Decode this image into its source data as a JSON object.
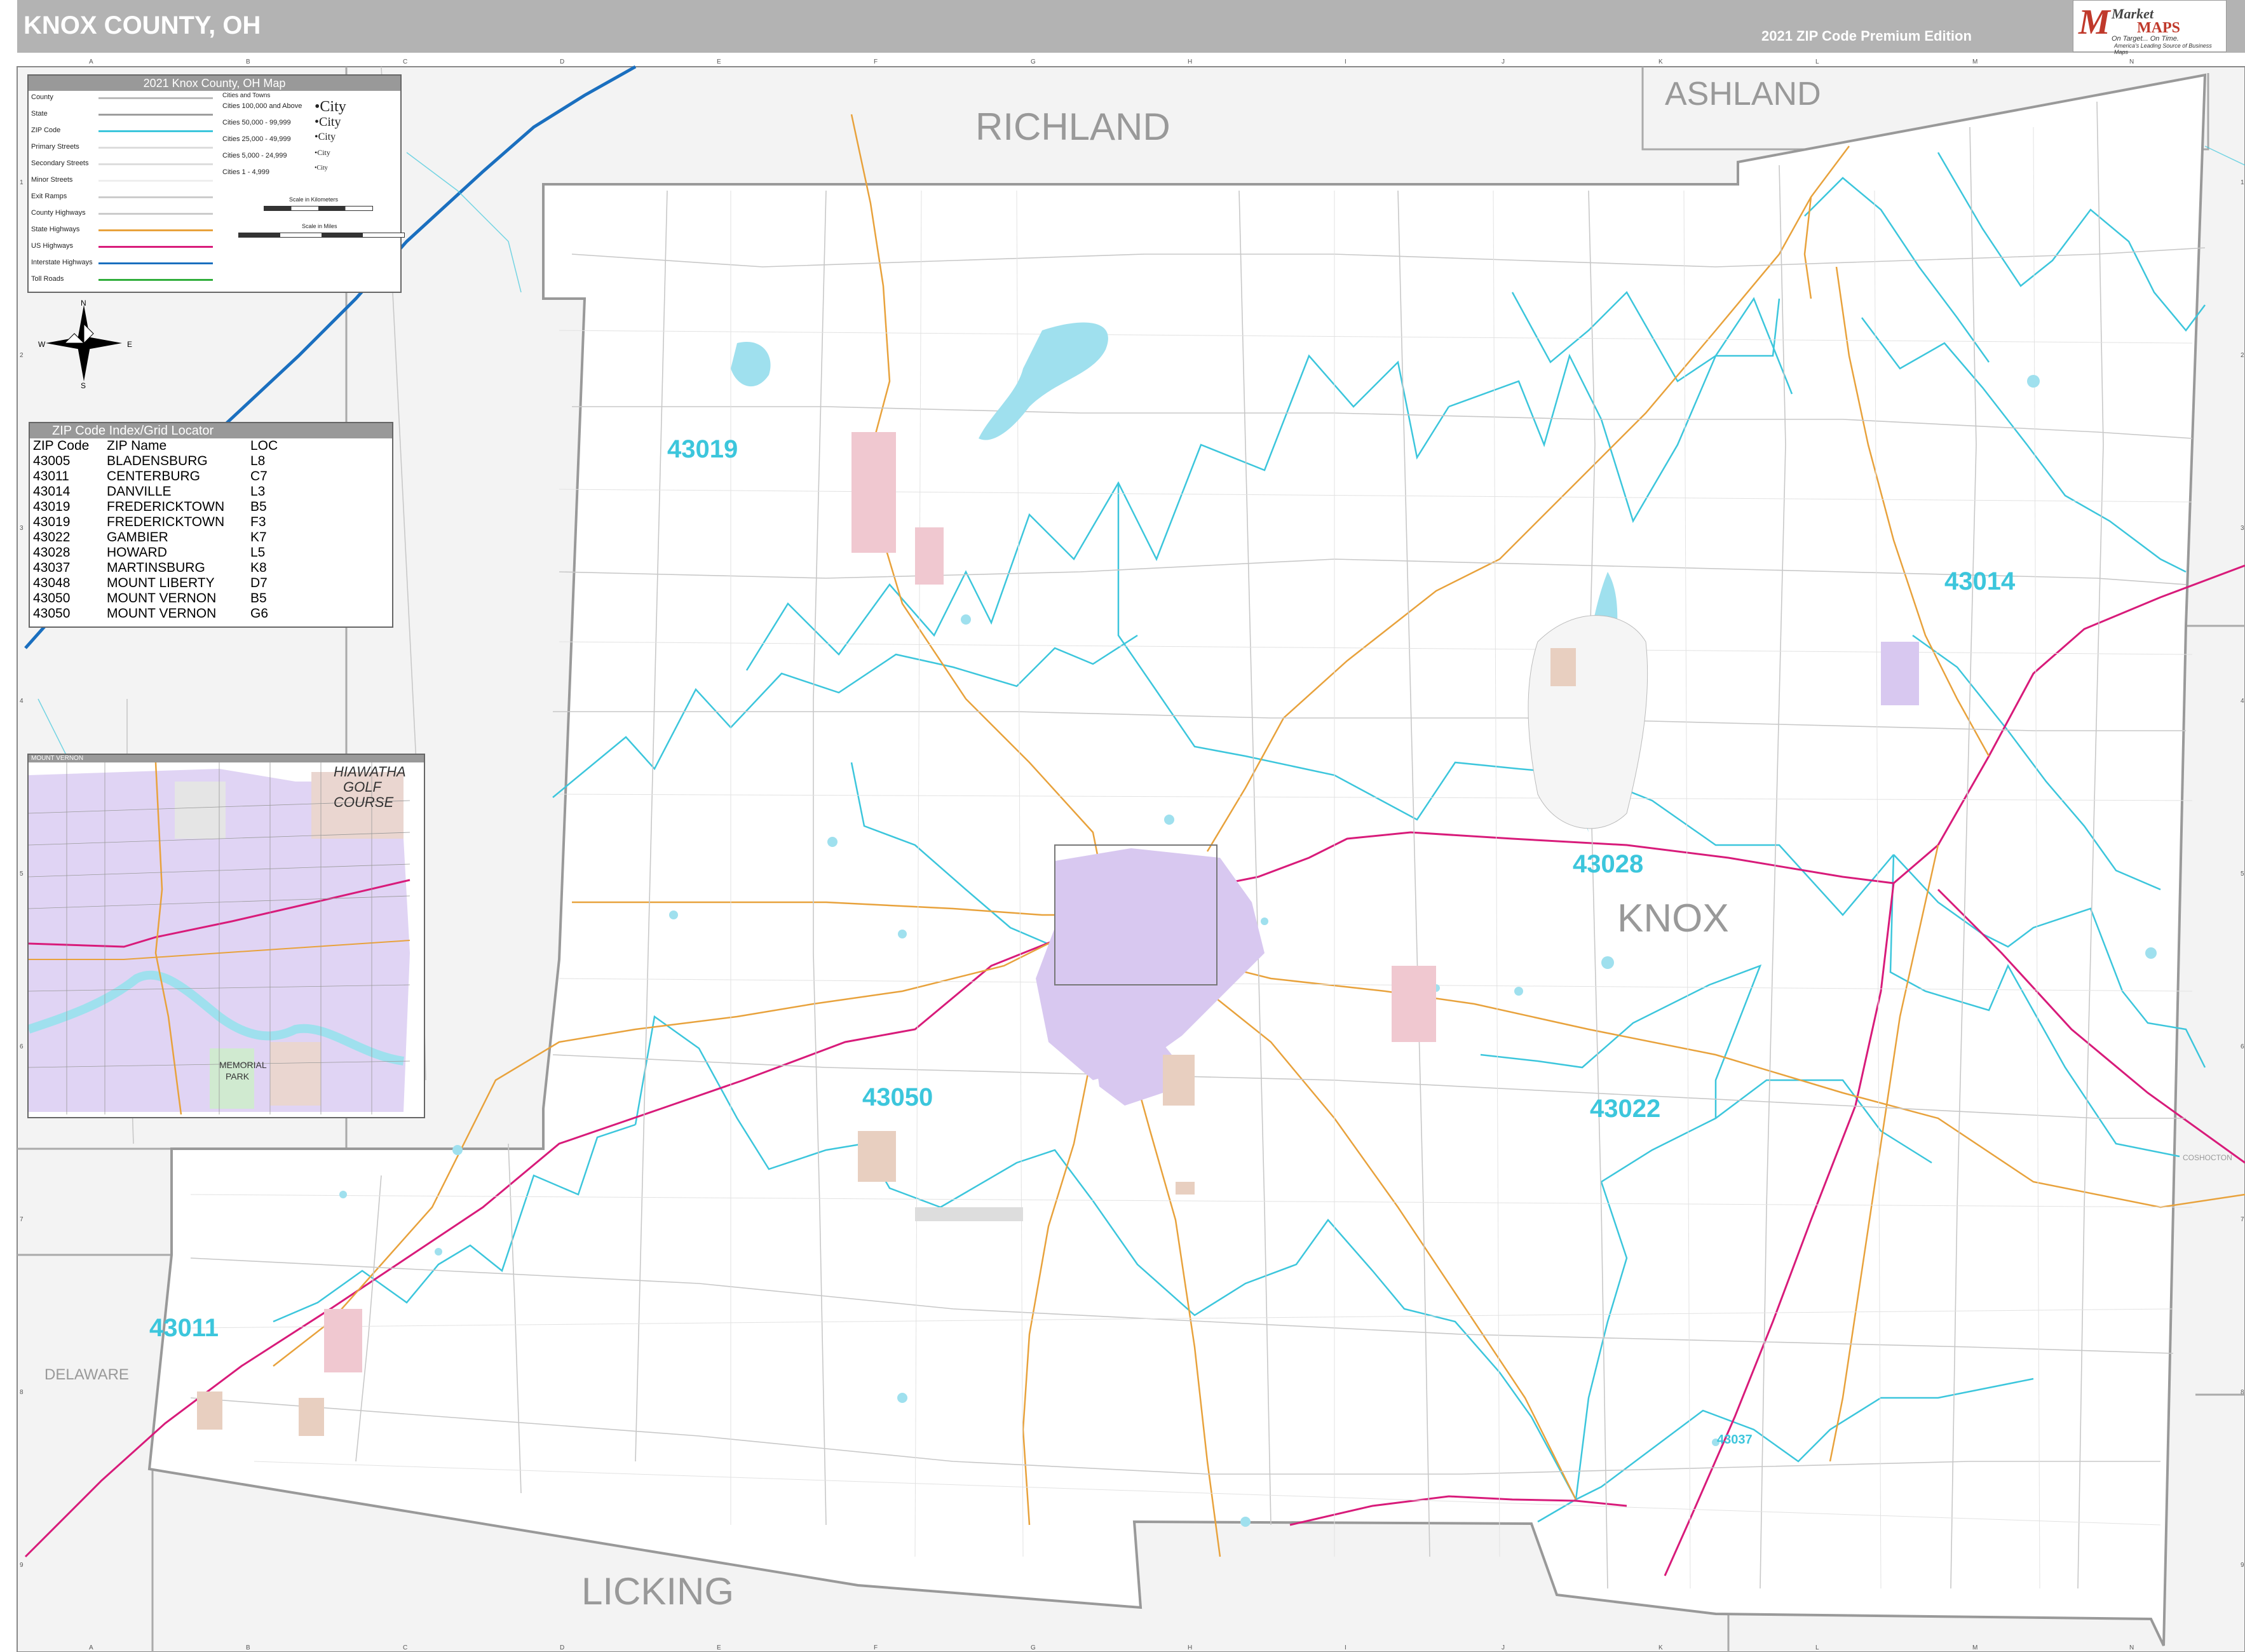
{
  "header": {
    "title": "KNOX COUNTY, OH",
    "edition": "2021 ZIP Code Premium Edition"
  },
  "logo": {
    "brand_top": "Market",
    "brand_bottom": "MAPS",
    "tagline": "On Target... On Time.",
    "subtagline": "America's Leading Source of Business Maps"
  },
  "legend": {
    "title": "2021 Knox County, OH Map",
    "items": [
      "County",
      "State",
      "ZIP Code",
      "Primary Streets",
      "Secondary Streets",
      "Minor Streets",
      "Exit Ramps",
      "County Highways",
      "State Highways",
      "US Highways",
      "Interstate Highways",
      "Toll Roads"
    ],
    "cities_title": "Cities and Towns",
    "cities": [
      {
        "range": "Cities 100,000 and Above",
        "sample": "•City"
      },
      {
        "range": "Cities 50,000 - 99,999",
        "sample": "•City"
      },
      {
        "range": "Cities 25,000 - 49,999",
        "sample": "•City"
      },
      {
        "range": "Cities 5,000 - 24,999",
        "sample": "•City"
      },
      {
        "range": "Cities 1 - 4,999",
        "sample": "•City"
      }
    ],
    "scale_km": "Scale in Kilometers",
    "scale_mi": "Scale in Miles"
  },
  "compass": {
    "n": "N",
    "s": "S",
    "e": "E",
    "w": "W"
  },
  "zip_index": {
    "title": "ZIP Code Index/Grid Locator",
    "headers": [
      "ZIP Code",
      "ZIP Name",
      "LOC"
    ],
    "rows": [
      [
        "43005",
        "BLADENSBURG",
        "L8"
      ],
      [
        "43011",
        "CENTERBURG",
        "C7"
      ],
      [
        "43014",
        "DANVILLE",
        "L3"
      ],
      [
        "43019",
        "FREDERICKTOWN",
        "B5"
      ],
      [
        "43019",
        "FREDERICKTOWN",
        "F3"
      ],
      [
        "43022",
        "GAMBIER",
        "K7"
      ],
      [
        "43028",
        "HOWARD",
        "L5"
      ],
      [
        "43037",
        "MARTINSBURG",
        "K8"
      ],
      [
        "43048",
        "MOUNT LIBERTY",
        "D7"
      ],
      [
        "43050",
        "MOUNT VERNON",
        "B5"
      ],
      [
        "43050",
        "MOUNT VERNON",
        "G6"
      ]
    ]
  },
  "inset": {
    "title": "MOUNT VERNON",
    "labels": [
      "HIAWATHA",
      "GOLF",
      "COURSE",
      "MEMORIAL",
      "PARK"
    ]
  },
  "counties": {
    "richland": "RICHLAND",
    "ashland": "ASHLAND",
    "knox": "KNOX",
    "licking": "LICKING",
    "delaware": "DELAWARE",
    "coshocton": "COSHOCTON"
  },
  "zip_labels": {
    "z43019": "43019",
    "z43014": "43014",
    "z43028": "43028",
    "z43050": "43050",
    "z43022": "43022",
    "z43011": "43011",
    "z43037": "43037"
  },
  "grid": {
    "cols": [
      "A",
      "B",
      "C",
      "D",
      "E",
      "F",
      "G",
      "H",
      "I",
      "J",
      "K",
      "L",
      "M",
      "N"
    ],
    "rows": [
      "1",
      "2",
      "3",
      "4",
      "5",
      "6",
      "7",
      "8",
      "9"
    ]
  },
  "colors": {
    "county_line": "#aaaaaa",
    "zip_line": "#3cc6dc",
    "state_hwy": "#e8a23c",
    "us_hwy": "#d81b7a",
    "interstate": "#1a6fbf",
    "water": "#9fe0ee",
    "city": "#d8c8f0",
    "town": "#f0c8d0",
    "outside": "#f2f2f2"
  }
}
